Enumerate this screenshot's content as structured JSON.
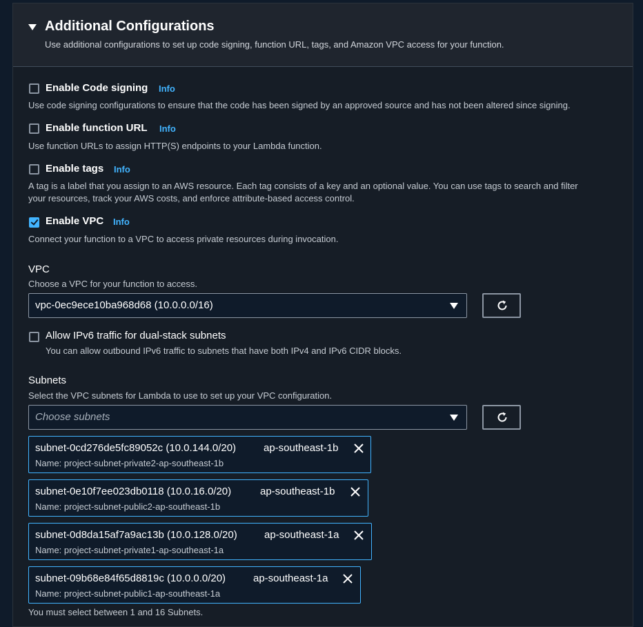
{
  "section": {
    "title": "Additional Configurations",
    "description": "Use additional configurations to set up code signing, function URL, tags, and Amazon VPC access for your function."
  },
  "options": [
    {
      "label": "Enable Code signing",
      "info": "Info",
      "checked": false,
      "description": "Use code signing configurations to ensure that the code has been signed by an approved source and has not been altered since signing."
    },
    {
      "label": "Enable function URL",
      "info": "Info",
      "checked": false,
      "description": "Use function URLs to assign HTTP(S) endpoints to your Lambda function."
    },
    {
      "label": "Enable tags",
      "info": "Info",
      "checked": false,
      "description_line1": "A tag is a label that you assign to an AWS resource. Each tag consists of a key and an optional value. You can use tags to search and filter",
      "description_line2": "your resources, track your AWS costs, and enforce attribute-based access control."
    },
    {
      "label": "Enable VPC",
      "info": "Info",
      "checked": true,
      "description": "Connect your function to a VPC to access private resources during invocation."
    }
  ],
  "vpc": {
    "label": "VPC",
    "description": "Choose a VPC for your function to access.",
    "selected": "vpc-0ec9ece10ba968d68 (10.0.0.0/16)"
  },
  "ipv6": {
    "label": "Allow IPv6 traffic for dual-stack subnets",
    "checked": false,
    "description": "You can allow outbound IPv6 traffic to subnets that have both IPv4 and IPv6 CIDR blocks."
  },
  "subnets": {
    "label": "Subnets",
    "description": "Select the VPC subnets for Lambda to use to set up your VPC configuration.",
    "placeholder": "Choose subnets",
    "selected": [
      {
        "id": "subnet-0cd276de5fc89052c (10.0.144.0/20)",
        "az": "ap-southeast-1b",
        "name": "Name: project-subnet-private2-ap-southeast-1b"
      },
      {
        "id": "subnet-0e10f7ee023db0118 (10.0.16.0/20)",
        "az": "ap-southeast-1b",
        "name": "Name: project-subnet-public2-ap-southeast-1b"
      },
      {
        "id": "subnet-0d8da15af7a9ac13b (10.0.128.0/20)",
        "az": "ap-southeast-1a",
        "name": "Name: project-subnet-private1-ap-southeast-1a"
      },
      {
        "id": "subnet-09b68e84f65d8819c (10.0.0.0/20)",
        "az": "ap-southeast-1a",
        "name": "Name: project-subnet-public1-ap-southeast-1a"
      }
    ],
    "constraint": "You must select between 1 and 16 Subnets."
  },
  "icons": {
    "refresh": "refresh-icon",
    "remove": "close-icon",
    "expand": "caret-down-icon"
  },
  "colors": {
    "accent": "#42b4ff",
    "panel_bg": "#161d26",
    "header_bg": "#1f252e",
    "input_bg": "#0f1b2a"
  }
}
